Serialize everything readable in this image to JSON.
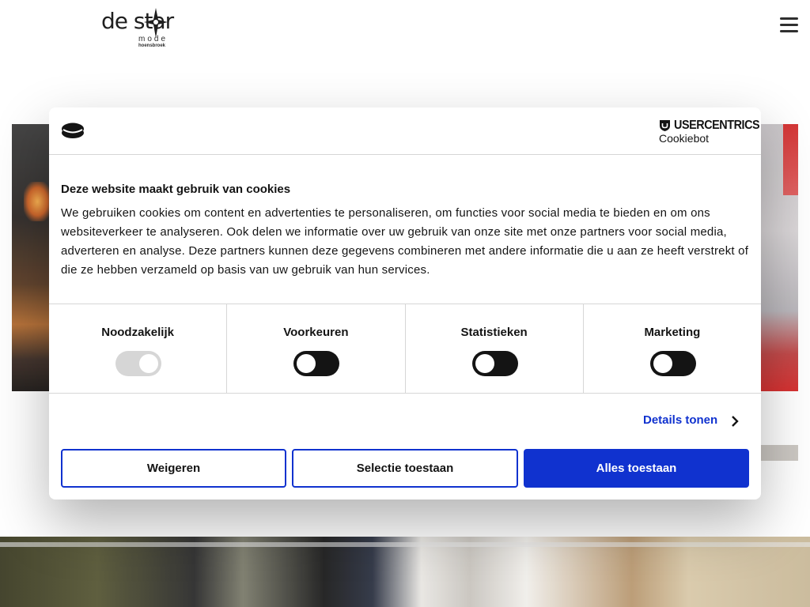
{
  "site": {
    "logo_text": "de star",
    "logo_sub": "mode",
    "logo_city": "hoensbroek",
    "menu_icon": "hamburger-menu-icon"
  },
  "cookie_dialog": {
    "brand_name": "USERCENTRICS",
    "brand_sub": "Cookiebot",
    "title": "Deze website maakt gebruik van cookies",
    "body": "We gebruiken cookies om content en advertenties te personaliseren, om functies voor social media te bieden en om ons websiteverkeer te analyseren. Ook delen we informatie over uw gebruik van onze site met onze partners voor social media, adverteren en analyse. Deze partners kunnen deze gegevens combineren met andere informatie die u aan ze heeft verstrekt of die ze hebben verzameld op basis van uw gebruik van hun services.",
    "categories": [
      {
        "label": "Noodzakelijk",
        "enabled": true,
        "disabled": true
      },
      {
        "label": "Voorkeuren",
        "enabled": false,
        "disabled": false
      },
      {
        "label": "Statistieken",
        "enabled": false,
        "disabled": false
      },
      {
        "label": "Marketing",
        "enabled": false,
        "disabled": false
      }
    ],
    "details_link": "Details tonen",
    "buttons": {
      "deny": "Weigeren",
      "allow_selection": "Selectie toestaan",
      "allow_all": "Alles toestaan"
    },
    "accent_color": "#1032cf"
  }
}
